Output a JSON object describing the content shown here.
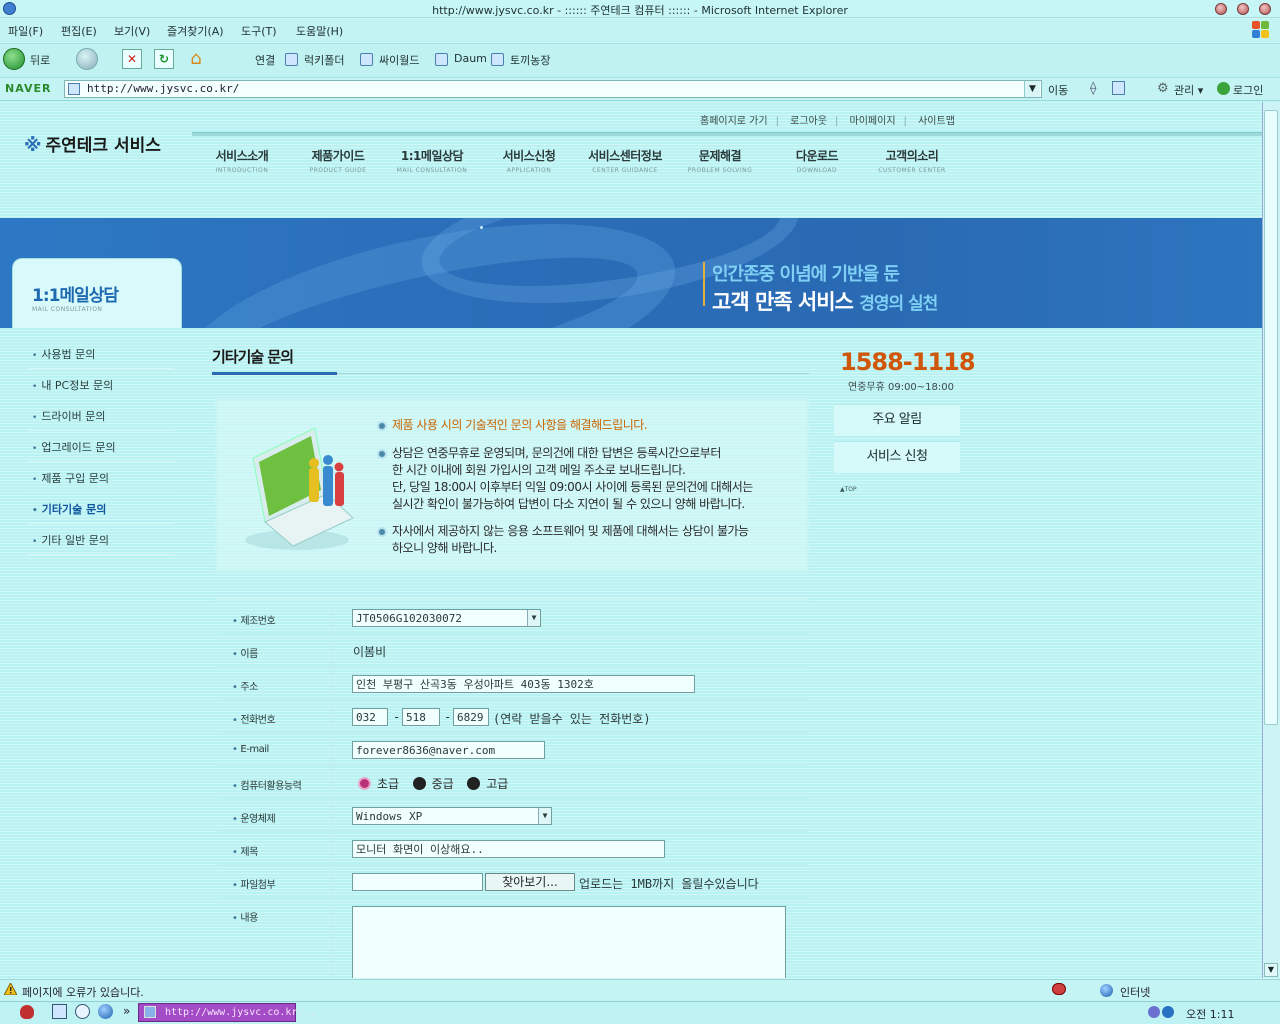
{
  "window": {
    "title": "http://www.jysvc.co.kr - :::::: 주연테크 컴퓨터 :::::: - Microsoft Internet Explorer"
  },
  "menubar": {
    "items": [
      "파일(F)",
      "편집(E)",
      "보기(V)",
      "즐겨찾기(A)",
      "도구(T)",
      "도움말(H)"
    ]
  },
  "toolbar": {
    "back_label": "뒤로",
    "links_label": "연결",
    "links": [
      "럭키폴더",
      "싸이월드",
      "Daum",
      "토끼농장"
    ]
  },
  "address_bar": {
    "logo": "NAVER",
    "url": "http://www.jysvc.co.kr/",
    "go_label": "이동",
    "manage_label": "관리",
    "login_label": "로그인"
  },
  "site": {
    "logo_text": "주연테크 서비스",
    "util_links": [
      "홈페이지로 가기",
      "로그아웃",
      "마이페이지",
      "사이트맵"
    ],
    "gnb": [
      {
        "label": "서비스소개",
        "sub": "INTRODUCTION"
      },
      {
        "label": "제품가이드",
        "sub": "PRODUCT GUIDE"
      },
      {
        "label": "1:1메일상담",
        "sub": "MAIL CONSULTATION"
      },
      {
        "label": "서비스신청",
        "sub": "APPLICATION"
      },
      {
        "label": "서비스센터정보",
        "sub": "CENTER GUIDANCE"
      },
      {
        "label": "문제해결",
        "sub": "PROBLEM SOLVING"
      },
      {
        "label": "다운로드",
        "sub": "DOWNLOAD"
      },
      {
        "label": "고객의소리",
        "sub": "CUSTOMER CENTER"
      }
    ],
    "banner": {
      "line1": "인간존중 이념에 기반을 둔",
      "line2_main": "고객 만족 서비스",
      "line2_accent": "경영의 실천"
    }
  },
  "sidebar": {
    "title": "1:1메일상담",
    "subtitle": "MAIL CONSULTATION",
    "items": [
      {
        "label": "사용법 문의",
        "active": false
      },
      {
        "label": "내 PC정보 문의",
        "active": false
      },
      {
        "label": "드라이버 문의",
        "active": false
      },
      {
        "label": "업그레이드 문의",
        "active": false
      },
      {
        "label": "제품 구입 문의",
        "active": false
      },
      {
        "label": "기타기술 문의",
        "active": true
      },
      {
        "label": "기타 일반 문의",
        "active": false
      }
    ]
  },
  "main": {
    "heading": "기타기술 문의",
    "notice": {
      "headline": "제품 사용 시의 기술적인 문의 사항을 해결해드립니다.",
      "para1": [
        "상담은 연중무휴로 운영되며, 문의건에 대한 답변은 등록시간으로부터",
        "한 시간 이내에 회원 가입시의 고객 메일 주소로 보내드립니다.",
        "단, 당일 18:00시 이후부터 익일 09:00시 사이에 등록된 문의건에 대해서는",
        "실시간 확인이 불가능하여 답변이 다소 지연이 될 수 있으니 양해 바랍니다."
      ],
      "para2": [
        "자사에서 제공하지 않는 응용 소프트웨어 및 제품에 대해서는 상담이 불가능",
        "하오니 양해 바랍니다."
      ]
    },
    "form": {
      "serial_label": "제조번호",
      "serial_value": "JT0506G102030072",
      "name_label": "이름",
      "name_value": "이봄비",
      "address_label": "주소",
      "address_value": "인천 부평구 산곡3동 우성아파트 403동 1302호",
      "phone_label": "전화번호",
      "phone1": "032",
      "phone2": "518",
      "phone3": "6829",
      "phone_sep": "-",
      "phone_note": "(연락 받을수 있는 전화번호)",
      "email_label": "E-mail",
      "email_value": "forever8636@naver.com",
      "skill_label": "컴퓨터활용능력",
      "skill_options": [
        "초급",
        "중급",
        "고급"
      ],
      "skill_selected": "초급",
      "os_label": "운영체제",
      "os_value": "Windows XP",
      "subject_label": "제목",
      "subject_value": "모니터 화면이 이상해요..",
      "file_label": "파일첨부",
      "file_value": "",
      "browse_label": "찾아보기...",
      "file_note": "업로드는 1MB까지 올릴수있습니다",
      "content_label": "내용",
      "content_value": ""
    }
  },
  "right_panel": {
    "phone": "1588-1118",
    "hours": "연중무휴 09:00~18:00",
    "buttons": [
      "주요 알림",
      "서비스 신청"
    ],
    "top_link": "TOP"
  },
  "statusbar": {
    "message": "페이지에 오류가 있습니다.",
    "zone": "인터넷"
  },
  "taskbar": {
    "window_label": "http://www.jysvc.co.kr...",
    "clock": "오전 1:11"
  }
}
